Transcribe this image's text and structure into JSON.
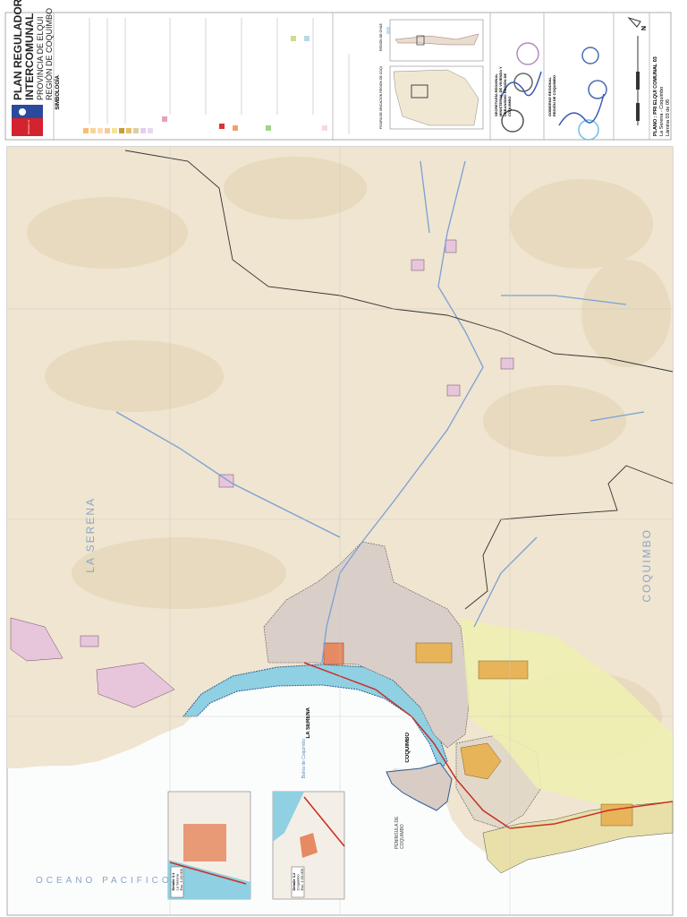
{
  "header": {
    "title_line1": "PLAN REGULADOR",
    "title_line2": "INTERCOMUNAL",
    "subtitle_line1": "PROVINCIA DE ELQUI",
    "subtitle_line2": "REGIÓN DE COQUIMBO",
    "symbology_label": "SIMBOLOGÍA",
    "ministry_logo_text": "Ministerio de Vivienda y Urbanismo"
  },
  "locator": {
    "region_title": "FIGURA DE UBICACIÓN REGIÓN DE COQUIMBO",
    "chile_title": "REGIÓN DE CHILE"
  },
  "signatures": {
    "seremi": "SECRETARÍA REGIONAL MINISTERIAL DE VIVIENDA Y URBANISMO REGIÓN DE COQUIMBO",
    "gobierno": "GOBIERNO REGIONAL REGIÓN DE COQUIMBO"
  },
  "plan_info": {
    "plano_label": "PLANO :",
    "plano_code": "PRI ELQUI COMUNAL 03",
    "communes": "La Serena - Coquimbo",
    "sheet": "Lámina 03 de 08",
    "north_label": "N"
  },
  "map_labels": {
    "la_serena_commune": "LA SERENA",
    "coquimbo_commune": "COQUIMBO",
    "la_serena_city": "LA SERENA",
    "coquimbo_city": "COQUIMBO",
    "ocean": "OCEANO PACIFICO",
    "bay": "Bahía de Coquimbo",
    "peninsula": "PENINSULA DE COQUIMBO"
  },
  "insets": [
    {
      "title": "Detalle 3.1",
      "place": "La Serena",
      "scale": "Esc. 1:20.000"
    },
    {
      "title": "Detalle 3.2",
      "place": "Coquimbo",
      "scale": "Esc. 1:20.000"
    }
  ],
  "colors": {
    "terrain": "#efe5d0",
    "sea_band": "#8fd0e2",
    "urban": "#d9cfc8",
    "center": "#e58a62",
    "highway": "#c8302a",
    "river": "#7a9fd6",
    "industrial": "#e8b45a",
    "extension": "#eef1b0"
  }
}
